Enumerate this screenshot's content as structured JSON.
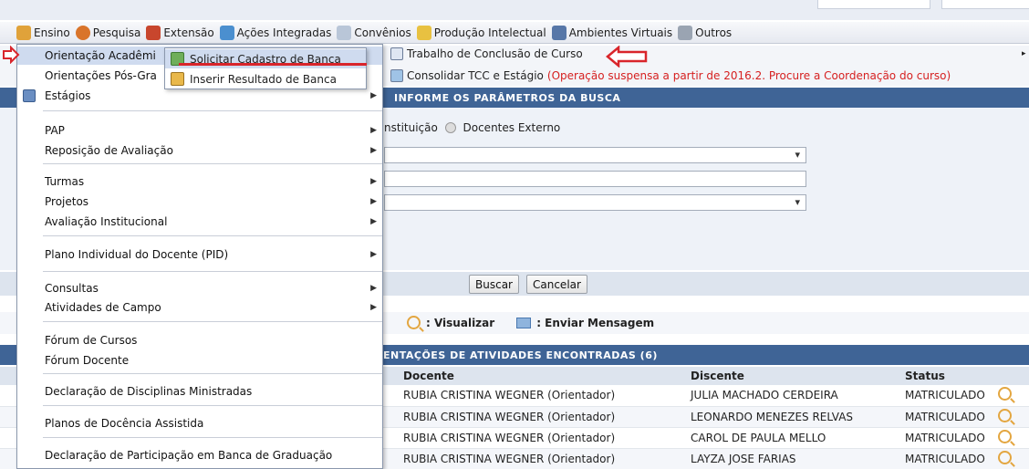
{
  "menubar": {
    "items": [
      {
        "label": "Ensino",
        "icon": "book-stack-icon",
        "color": "#e0a23a"
      },
      {
        "label": "Pesquisa",
        "icon": "flask-icon",
        "color": "#d9742a"
      },
      {
        "label": "Extensão",
        "icon": "heart-icon",
        "color": "#c8462d"
      },
      {
        "label": "Ações Integradas",
        "icon": "puzzle-icon",
        "color": "#4b8fcf"
      },
      {
        "label": "Convênios",
        "icon": "document-icon",
        "color": "#b9c6d8"
      },
      {
        "label": "Produção Intelectual",
        "icon": "notebook-icon",
        "color": "#e8c141"
      },
      {
        "label": "Ambientes Virtuais",
        "icon": "network-icon",
        "color": "#5777a8"
      },
      {
        "label": "Outros",
        "icon": "box-icon",
        "color": "#9aa4b2"
      }
    ]
  },
  "dropdown": {
    "items": [
      {
        "label": "Orientação Acadêmi"
      },
      {
        "label": "Orientações Pós-Gra"
      },
      {
        "label": "Estágios"
      },
      {
        "label": "PAP"
      },
      {
        "label": "Reposição de Avaliação"
      },
      {
        "label": "Turmas"
      },
      {
        "label": "Projetos"
      },
      {
        "label": "Avaliação Institucional"
      },
      {
        "label": "Plano Individual do Docente (PID)"
      },
      {
        "label": "Consultas"
      },
      {
        "label": "Atividades de Campo"
      },
      {
        "label": "Fórum de Cursos"
      },
      {
        "label": "Fórum Docente"
      },
      {
        "label": "Declaração de Disciplinas Ministradas"
      },
      {
        "label": "Planos de Docência Assistida"
      },
      {
        "label": "Declaração de Participação em Banca de Graduação"
      }
    ]
  },
  "submenu": {
    "items": [
      {
        "label": "Solicitar Cadastro de Banca"
      },
      {
        "label": "Inserir Resultado de Banca"
      }
    ]
  },
  "links": {
    "tcc": "Trabalho de Conclusão de Curso",
    "consolidar": "Consolidar TCC e Estágio",
    "consolidar_warning": "(Operação suspensa a partir de 2016.2. Procure a Coordenação do curso)"
  },
  "search": {
    "title": "Informe os Parâmetros da Busca",
    "radio_partial": "nstituição",
    "radio_externo": "Docentes Externo",
    "buscar": "Buscar",
    "cancelar": "Cancelar"
  },
  "legend": {
    "visualizar": ": Visualizar",
    "enviar": ": Enviar Mensagem"
  },
  "results": {
    "title": "entações de Atividades Encontradas (6)",
    "columns": [
      "Docente",
      "Discente",
      "Status"
    ],
    "rows": [
      {
        "docente": "RUBIA CRISTINA WEGNER (Orientador)",
        "discente": "JULIA MACHADO CERDEIRA",
        "status": "MATRICULADO"
      },
      {
        "docente": "RUBIA CRISTINA WEGNER (Orientador)",
        "discente": "LEONARDO MENEZES RELVAS",
        "status": "MATRICULADO"
      },
      {
        "docente": "RUBIA CRISTINA WEGNER (Orientador)",
        "discente": "CAROL DE PAULA MELLO",
        "status": "MATRICULADO"
      },
      {
        "docente": "RUBIA CRISTINA WEGNER (Orientador)",
        "discente": "LAYZA JOSE FARIAS",
        "status": "MATRICULADO"
      }
    ]
  },
  "colors": {
    "header_blue": "#3f6496",
    "highlight": "#cfdbef",
    "annotation_red": "#d9252b",
    "warning_red": "#d62020"
  }
}
